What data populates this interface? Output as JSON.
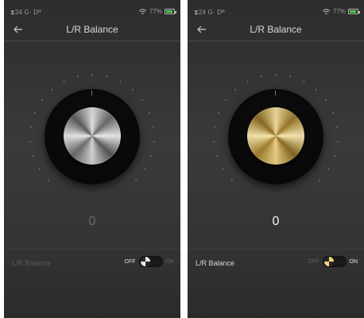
{
  "screens": [
    {
      "status": {
        "left": "⧗24 G· Dᴿ",
        "battery": "77%"
      },
      "title": "L/R Balance",
      "dial_value": "0",
      "setting": {
        "label": "L/R Balance",
        "off_label": "OFF",
        "on_label": "ON",
        "state": "off"
      },
      "colors": {
        "knob": "silver",
        "value_text": "#6d6d6b",
        "label_text": "#5a5a58",
        "off_text": "#dcdcdc",
        "on_text": "#666664"
      }
    },
    {
      "status": {
        "left": "⧗24 G· Dᴿ",
        "battery": "77%"
      },
      "title": "L/R Balance",
      "dial_value": "0",
      "setting": {
        "label": "L/R Balance",
        "off_label": "OFF",
        "on_label": "ON",
        "state": "on"
      },
      "colors": {
        "knob": "gold",
        "value_text": "#f2f2f2",
        "label_text": "#d8d8d8",
        "off_text": "#5f5f5d",
        "on_text": "#e6e6e6"
      }
    }
  ]
}
